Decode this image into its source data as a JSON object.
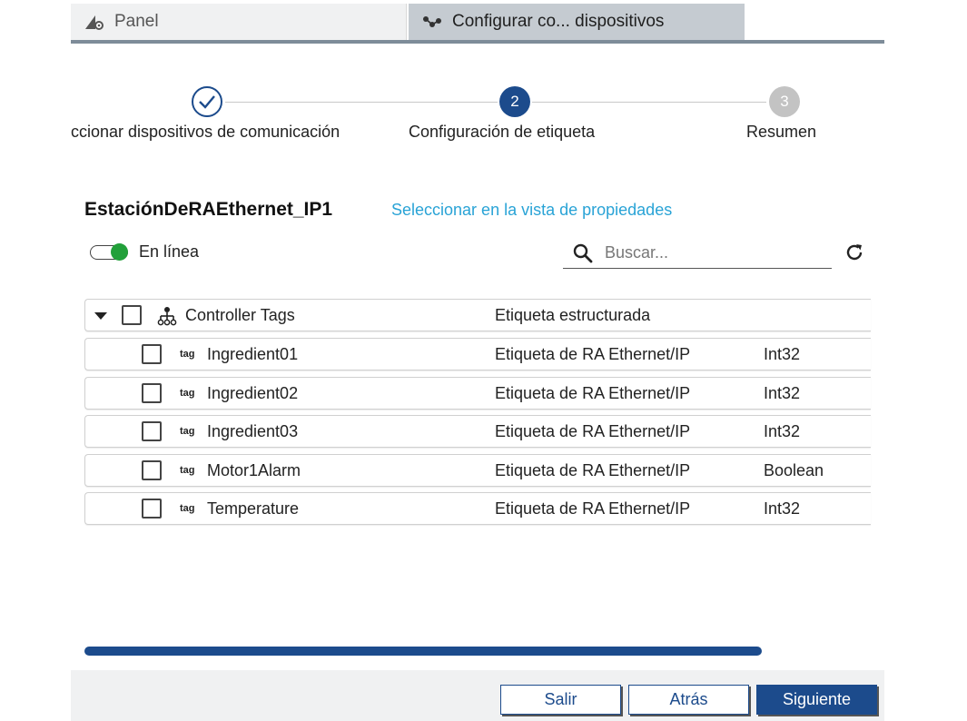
{
  "tabs": [
    {
      "label": "Panel",
      "icon": "panel-gear-icon",
      "active": false
    },
    {
      "label": "Configurar co... dispositivos",
      "icon": "network-nodes-icon",
      "active": true
    }
  ],
  "stepper": {
    "steps": [
      {
        "label": "ccionar dispositivos de comunicación",
        "state": "done",
        "number": ""
      },
      {
        "label": "Configuración de etiqueta",
        "state": "active",
        "number": "2"
      },
      {
        "label": "Resumen",
        "state": "pending",
        "number": "3"
      }
    ]
  },
  "device": {
    "title": "EstaciónDeRAEthernet_IP1",
    "link": "Seleccionar en la vista de propiedades"
  },
  "online": {
    "label": "En línea",
    "on": true
  },
  "search": {
    "placeholder": "Buscar..."
  },
  "table": {
    "root": {
      "name": "Controller Tags",
      "kind": "Etiqueta estructurada",
      "type": ""
    },
    "rows": [
      {
        "icon_text": "tag",
        "name": "Ingredient01",
        "kind": "Etiqueta de RA Ethernet/IP",
        "type": "Int32"
      },
      {
        "icon_text": "tag",
        "name": "Ingredient02",
        "kind": "Etiqueta de RA Ethernet/IP",
        "type": "Int32"
      },
      {
        "icon_text": "tag",
        "name": "Ingredient03",
        "kind": "Etiqueta de RA Ethernet/IP",
        "type": "Int32"
      },
      {
        "icon_text": "tag",
        "name": "Motor1Alarm",
        "kind": "Etiqueta de RA Ethernet/IP",
        "type": "Boolean"
      },
      {
        "icon_text": "tag",
        "name": "Temperature",
        "kind": "Etiqueta de RA Ethernet/IP",
        "type": "Int32"
      }
    ]
  },
  "footer": {
    "exit_label": "Salir",
    "back_label": "Atrás",
    "next_label": "Siguiente"
  },
  "colors": {
    "primary": "#1c4b8c",
    "link": "#29a3d6",
    "online": "#22a03a",
    "tab_active_bg": "#c5cbd1"
  }
}
